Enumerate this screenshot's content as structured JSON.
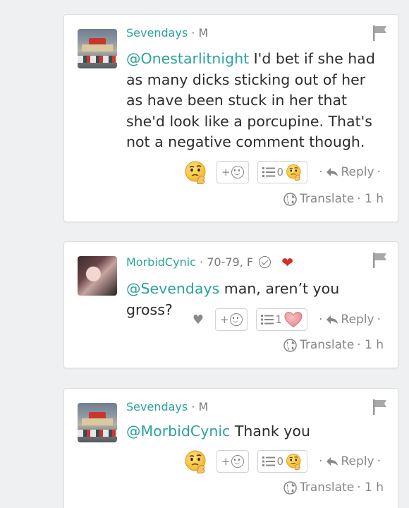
{
  "posts": [
    {
      "username": "Sevendays",
      "user_meta": "· M",
      "mention": "@Onestarlitnight",
      "body": " I'd bet if she had as many dicks sticking out of her as have been stuck in her that she'd look like a porcupine. That's not a negative comment though.",
      "react_count": "0",
      "reply_label": "Reply",
      "translate_label": "Translate",
      "time": "· 1 h"
    },
    {
      "username": "MorbidCynic",
      "user_meta": "· 70-79, F",
      "mention": "@Sevendays",
      "body": " man, aren’t you gross?",
      "react_count": "1",
      "reply_label": "Reply",
      "translate_label": "Translate",
      "time": "· 1 h"
    },
    {
      "username": "Sevendays",
      "user_meta": "· M",
      "mention": "@MorbidCynic",
      "body": " Thank you",
      "react_count": "0",
      "reply_label": "Reply",
      "translate_label": "Translate",
      "time": "· 1 h"
    }
  ],
  "labels": {
    "plus": "+",
    "dot": "·"
  },
  "colors": {
    "accent": "#2aa39a",
    "heart_red": "#d62b2b",
    "muted": "#888888"
  },
  "icons": [
    "flag-icon",
    "smile-icon",
    "list-icon",
    "reply-icon",
    "globe-icon",
    "heart-icon",
    "verified-icon",
    "thinking-face-icon"
  ]
}
